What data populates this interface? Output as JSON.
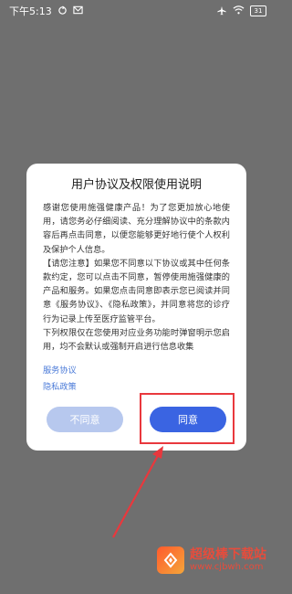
{
  "status_bar": {
    "time": "下午5:13",
    "battery": "31"
  },
  "dialog": {
    "title": "用户协议及权限使用说明",
    "paragraphs": [
      "感谢您使用施强健康产品！为了您更加放心地使用，请您务必仔细阅读、充分理解协议中的条款内容后再点击同意，以便您能够更好地行使个人权利及保护个人信息。",
      "【请您注意】如果您不同意以下协议或其中任何条款约定，您可以点击不同意，暂停使用施强健康的产品和服务。如果您点击同意即表示您已阅读并同意《服务协议》、《隐私政策》，并同意将您的诊疗行为记录上传至医疗监管平台。",
      "下列权限仅在您使用对应业务功能时弹窗明示您启用，均不会默认或强制开启进行信息收集"
    ],
    "links": {
      "service": "服务协议",
      "privacy": "隐私政策"
    },
    "buttons": {
      "disagree": "不同意",
      "agree": "同意"
    }
  },
  "watermark": {
    "title": "超级棒下载站",
    "url": "www.cjbwh.com"
  },
  "colors": {
    "overlay": "#6f6f6f",
    "agree": "#3a64e2",
    "disagree": "#b7c8ee",
    "link": "#4a7ad8",
    "highlight": "#e9383d"
  }
}
